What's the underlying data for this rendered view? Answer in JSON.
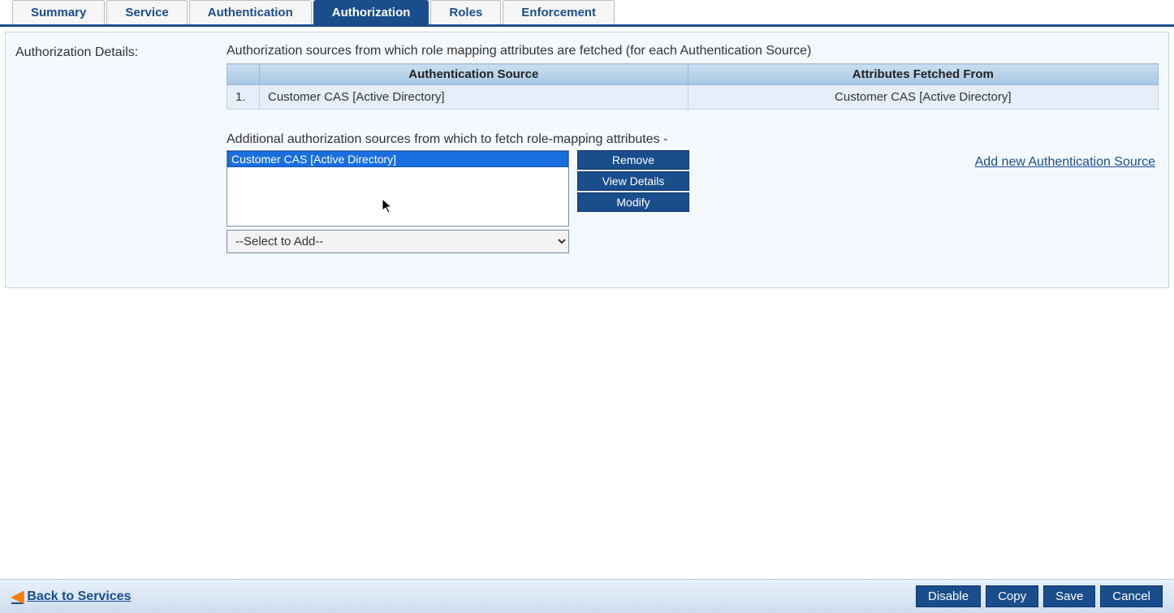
{
  "tabs": {
    "summary": "Summary",
    "service": "Service",
    "authentication": "Authentication",
    "authorization": "Authorization",
    "roles": "Roles",
    "enforcement": "Enforcement",
    "active": "authorization"
  },
  "panel": {
    "sideLabel": "Authorization Details:",
    "intro": "Authorization sources from which role mapping attributes are fetched (for each Authentication Source)",
    "tableHeaders": {
      "num": "",
      "authSource": "Authentication Source",
      "attrFrom": "Attributes Fetched From"
    },
    "rows": [
      {
        "num": "1.",
        "authSource": "Customer CAS [Active Directory]",
        "attrFrom": "Customer CAS [Active Directory]"
      }
    ],
    "addText": "Additional authorization sources from which to fetch role-mapping attributes -",
    "listItems": [
      {
        "label": "Customer CAS [Active Directory]",
        "selected": true
      }
    ],
    "selectPlaceholder": "--Select to Add--",
    "buttons": {
      "remove": "Remove",
      "viewDetails": "View Details",
      "modify": "Modify"
    },
    "addNewLink": "Add new Authentication Source"
  },
  "footer": {
    "back": "Back to Services",
    "disable": "Disable",
    "copy": "Copy",
    "save": "Save",
    "cancel": "Cancel"
  }
}
